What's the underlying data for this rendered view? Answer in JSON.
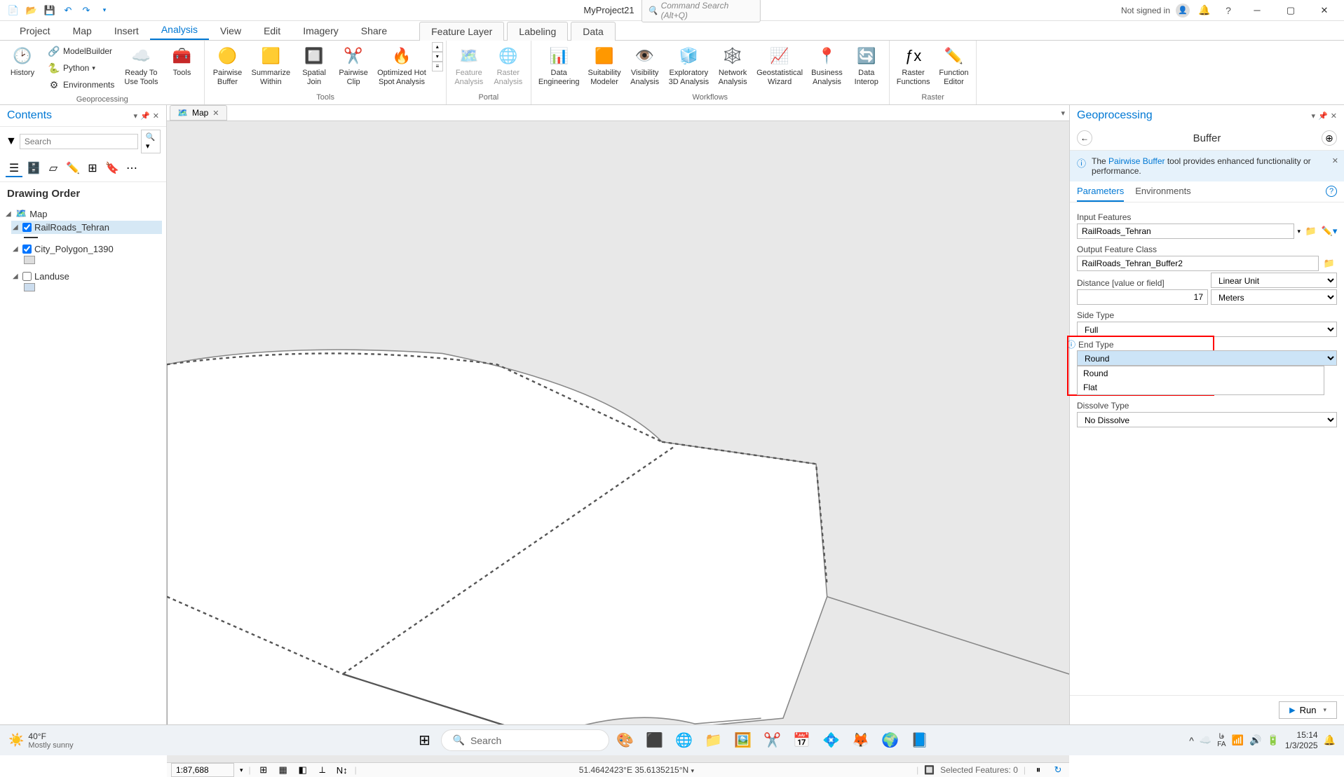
{
  "titlebar": {
    "project_name": "MyProject21",
    "command_search_placeholder": "Command Search (Alt+Q)",
    "signin": "Not signed in"
  },
  "ribbon": {
    "tabs": [
      "Project",
      "Map",
      "Insert",
      "Analysis",
      "View",
      "Edit",
      "Imagery",
      "Share"
    ],
    "active_tab": "Analysis",
    "contextual_tabs": [
      "Feature Layer",
      "Labeling",
      "Data"
    ],
    "groups": {
      "geoprocessing": {
        "label": "Geoprocessing",
        "history": "History",
        "ready_to_use": "Ready To\nUse Tools",
        "tools": "Tools",
        "modelbuilder": "ModelBuilder",
        "python": "Python",
        "environments": "Environments"
      },
      "tools": {
        "label": "Tools",
        "buttons": [
          "Pairwise\nBuffer",
          "Summarize\nWithin",
          "Spatial\nJoin",
          "Pairwise\nClip",
          "Optimized Hot\nSpot Analysis"
        ]
      },
      "portal": {
        "label": "Portal",
        "feature_analysis": "Feature\nAnalysis",
        "raster_analysis": "Raster\nAnalysis"
      },
      "workflows": {
        "label": "Workflows",
        "buttons": [
          "Data\nEngineering",
          "Suitability\nModeler",
          "Visibility\nAnalysis",
          "Exploratory\n3D Analysis",
          "Network\nAnalysis",
          "Geostatistical\nWizard",
          "Business\nAnalysis",
          "Data\nInterop"
        ]
      },
      "raster": {
        "label": "Raster",
        "raster_functions": "Raster\nFunctions",
        "function_editor": "Function\nEditor"
      }
    }
  },
  "contents": {
    "title": "Contents",
    "search_placeholder": "Search",
    "drawing_order": "Drawing Order",
    "map_root": "Map",
    "layers": [
      {
        "name": "RailRoads_Tehran",
        "checked": true,
        "selected": true,
        "symbol": "line"
      },
      {
        "name": "City_Polygon_1390",
        "checked": true,
        "selected": false,
        "symbol": "poly_gray"
      },
      {
        "name": "Landuse",
        "checked": false,
        "selected": false,
        "symbol": "poly_blue"
      }
    ]
  },
  "map": {
    "tab_name": "Map",
    "scale": "1:87,688",
    "coords": "51.4642423°E 35.6135215°N",
    "selected_features": "Selected Features: 0"
  },
  "gp": {
    "title": "Geoprocessing",
    "tool": "Buffer",
    "info_prefix": "The ",
    "info_link": "Pairwise Buffer",
    "info_suffix": " tool provides enhanced functionality or performance.",
    "tab_parameters": "Parameters",
    "tab_environments": "Environments",
    "params": {
      "input_features_label": "Input Features",
      "input_features_value": "RailRoads_Tehran",
      "output_fc_label": "Output Feature Class",
      "output_fc_value": "RailRoads_Tehran_Buffer2",
      "distance_label": "Distance [value or field]",
      "distance_mode": "Linear Unit",
      "distance_value": "17",
      "distance_unit": "Meters",
      "side_type_label": "Side Type",
      "side_type_value": "Full",
      "end_type_label": "End Type",
      "end_type_value": "Round",
      "end_type_options": [
        "Round",
        "Flat"
      ],
      "dissolve_type_label": "Dissolve Type",
      "dissolve_type_value": "No Dissolve"
    },
    "run": "Run"
  },
  "taskbar": {
    "weather_temp": "40°F",
    "weather_desc": "Mostly sunny",
    "search_placeholder": "Search",
    "lang": "FA",
    "lang_sub": "فا",
    "time": "15:14",
    "date": "1/3/2025"
  }
}
